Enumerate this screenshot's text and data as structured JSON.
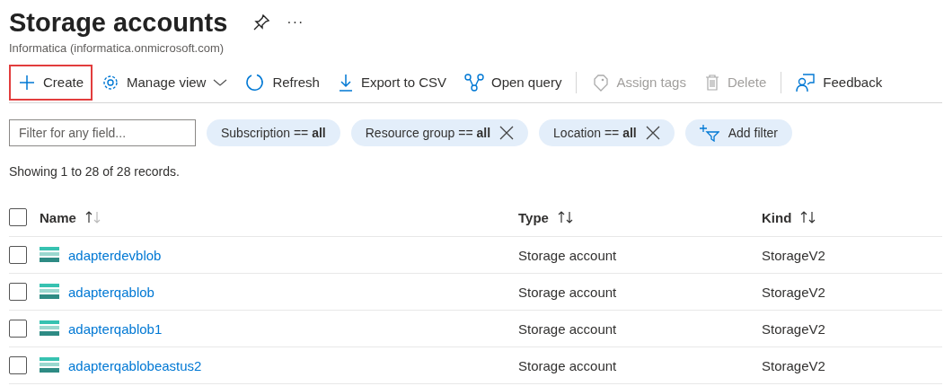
{
  "page": {
    "title": "Storage accounts",
    "subtitle": "Informatica (informatica.onmicrosoft.com)",
    "more": "···"
  },
  "toolbar": [
    {
      "kind": "create",
      "label": "Create",
      "disabled": false,
      "highlighted": true
    },
    {
      "kind": "manage",
      "label": "Manage view",
      "disabled": false,
      "highlighted": false
    },
    {
      "kind": "refresh",
      "label": "Refresh",
      "disabled": false,
      "highlighted": false
    },
    {
      "kind": "export",
      "label": "Export to CSV",
      "disabled": false,
      "highlighted": false
    },
    {
      "kind": "query",
      "label": "Open query",
      "disabled": false,
      "highlighted": false
    },
    {
      "kind": "separator"
    },
    {
      "kind": "tags",
      "label": "Assign tags",
      "disabled": true,
      "highlighted": false
    },
    {
      "kind": "delete",
      "label": "Delete",
      "disabled": true,
      "highlighted": false
    },
    {
      "kind": "separator"
    },
    {
      "kind": "feedback",
      "label": "Feedback",
      "disabled": false,
      "highlighted": false
    }
  ],
  "filter": {
    "placeholder": "Filter for any field..."
  },
  "pills": [
    {
      "kind": "filter",
      "label": "Subscription == **all**",
      "removable": false
    },
    {
      "kind": "filter",
      "label": "Resource group == **all**",
      "removable": true
    },
    {
      "kind": "filter",
      "label": "Location == **all**",
      "removable": true
    },
    {
      "kind": "add",
      "label": "Add filter",
      "removable": false
    }
  ],
  "records": "Showing 1 to 28 of 28 records.",
  "table": {
    "select_all": {
      "checked": false
    },
    "columns": [
      {
        "label": "Name",
        "sorted": true
      },
      {
        "label": "Type",
        "sorted": false
      },
      {
        "label": "Kind",
        "sorted": false
      }
    ],
    "rows": [
      {
        "checked": false,
        "name": "adapterdevblob",
        "type": "Storage account",
        "kind": "StorageV2"
      },
      {
        "checked": false,
        "name": "adapterqablob",
        "type": "Storage account",
        "kind": "StorageV2"
      },
      {
        "checked": false,
        "name": "adapterqablob1",
        "type": "Storage account",
        "kind": "StorageV2"
      },
      {
        "checked": false,
        "name": "adapterqablobeastus2",
        "type": "Storage account",
        "kind": "StorageV2"
      }
    ]
  }
}
